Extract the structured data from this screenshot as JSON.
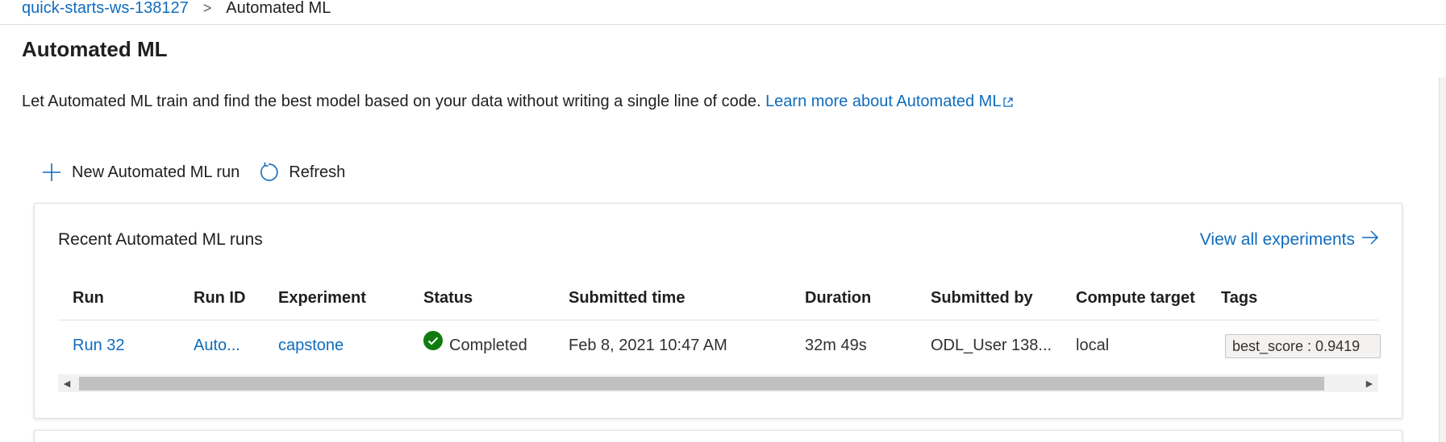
{
  "breadcrumb": {
    "workspace": "quick-starts-ws-138127",
    "separator": ">",
    "current": "Automated ML"
  },
  "page": {
    "title": "Automated ML",
    "description": "Let Automated ML train and find the best model based on your data without writing a single line of code. ",
    "learn_more": "Learn more about Automated ML"
  },
  "toolbar": {
    "new_run_label": "New Automated ML run",
    "refresh_label": "Refresh"
  },
  "recent_runs": {
    "title": "Recent Automated ML runs",
    "view_all_label": "View all experiments",
    "columns": {
      "run": "Run",
      "run_id": "Run ID",
      "experiment": "Experiment",
      "status": "Status",
      "submitted_time": "Submitted time",
      "duration": "Duration",
      "submitted_by": "Submitted by",
      "compute_target": "Compute target",
      "tags": "Tags"
    },
    "rows": [
      {
        "run": "Run 32",
        "run_id": "Auto...",
        "experiment": "capstone",
        "status": "Completed",
        "submitted_time": "Feb 8, 2021 10:47 AM",
        "duration": "32m 49s",
        "submitted_by": "ODL_User 138...",
        "compute_target": "local",
        "tag": "best_score : 0.9419"
      }
    ]
  },
  "colors": {
    "link": "#0f6cbd",
    "status_success": "#107c10",
    "text": "#201f1e"
  },
  "icons": {
    "add": "add-icon",
    "refresh": "refresh-icon",
    "external_link": "external-link-icon",
    "arrow_right": "arrow-right-icon",
    "status_completed": "check-circle-icon"
  }
}
